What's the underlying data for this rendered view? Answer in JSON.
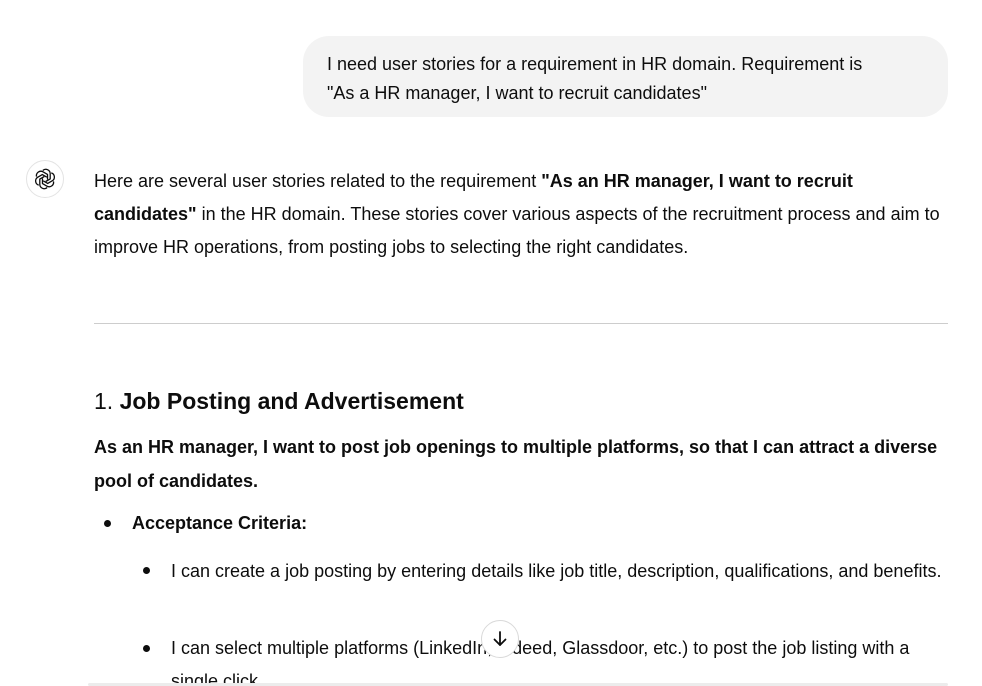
{
  "user_message": {
    "line1": "I need user stories for a requirement in HR domain. Requirement is",
    "line2": "\"As a HR manager, I want to recruit candidates\""
  },
  "assistant": {
    "avatar_icon": "openai-logo-icon",
    "intro_prefix": "Here are several user stories related to the requirement ",
    "intro_bold": "\"As an HR manager, I want to recruit candidates\"",
    "intro_suffix": " in the HR domain. These stories cover various aspects of the recruitment process and aim to improve HR operations, from posting jobs to selecting the right candidates.",
    "section": {
      "number": "1.",
      "title": "Job Posting and Advertisement",
      "story": "As an HR manager, I want to post job openings to multiple platforms, so that I can attract a diverse pool of candidates.",
      "criteria_label": "Acceptance Criteria:",
      "criteria": [
        "I can create a job posting by entering details like job title, description, qualifications, and benefits.",
        "I can select multiple platforms (LinkedIn, Indeed, Glassdoor, etc.) to post the job listing with a single click."
      ]
    }
  },
  "scroll_button": {
    "icon": "arrow-down-icon"
  }
}
